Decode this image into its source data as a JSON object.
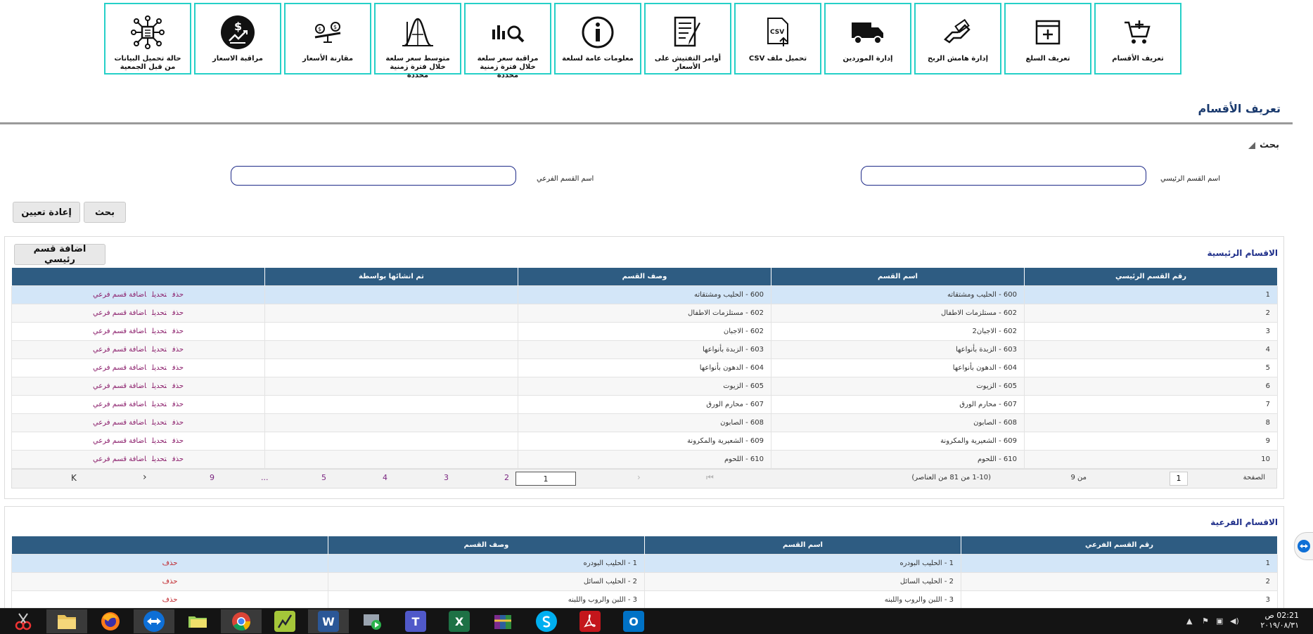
{
  "toolbar": {
    "tiles": [
      {
        "label": "تعريف الأقسام",
        "icon": "cart-add-icon"
      },
      {
        "label": "تعريف السلع",
        "icon": "add-box-icon"
      },
      {
        "label": "إدارة هامش الربح",
        "icon": "hand-money-icon"
      },
      {
        "label": "إدارة الموردين",
        "icon": "truck-icon"
      },
      {
        "label": "تحميل ملف CSV",
        "icon": "csv-upload-icon"
      },
      {
        "label": "أوامر التفتيش على الأسعار",
        "icon": "inspection-order-icon"
      },
      {
        "label": "معلومات عامة لسلعة",
        "icon": "info-icon"
      },
      {
        "label": "مراقبة سعر سلعة خلال فترة زمنية محددة",
        "icon": "chart-search-icon"
      },
      {
        "label": "متوسط سعر سلعة خلال فترة زمنية محددة",
        "icon": "bell-curve-icon"
      },
      {
        "label": "مقارنة الأسعار",
        "icon": "price-compare-icon"
      },
      {
        "label": "مراقبة الاسعار",
        "icon": "price-monitor-icon"
      },
      {
        "label": "حالة تحميل البيانات من قبل الجمعية",
        "icon": "data-network-icon"
      }
    ]
  },
  "page": {
    "title": "تعريف الأقسام",
    "search_toggle": "بحث"
  },
  "search": {
    "main_category_label": "اسم القسم الرئيسي",
    "main_category_value": "",
    "sub_category_label": "اسم القسم الفرعي",
    "sub_category_value": "",
    "search_button": "بحث",
    "reset_button": "إعادة تعيين"
  },
  "main_categories": {
    "title": "الاقسام الرئيسية",
    "add_button": "اضافة قسم رئيسي",
    "columns": [
      "رقم القسم الرئيسي",
      "اسم القسم",
      "وصف القسم",
      "تم انشائها بواسطة",
      ""
    ],
    "actions": {
      "delete": "حذف",
      "edit": "تحديل",
      "add_sub": "اضافة قسم فرعي"
    },
    "rows": [
      {
        "no": "1",
        "name": "600 - الحليب ومشتقاته",
        "desc": "600 - الحليب ومشتقاته",
        "created_by": ""
      },
      {
        "no": "2",
        "name": "602 - مستلزمات الاطفال",
        "desc": "602 - مستلزمات الاطفال",
        "created_by": ""
      },
      {
        "no": "3",
        "name": "602 - الاجبان2",
        "desc": "602 - الاجبان",
        "created_by": ""
      },
      {
        "no": "4",
        "name": "603 - الزبدة بأنواعها",
        "desc": "603 - الزبدة بأنواعها",
        "created_by": ""
      },
      {
        "no": "5",
        "name": "604 - الدهون بأنواعها",
        "desc": "604 - الدهون بأنواعها",
        "created_by": ""
      },
      {
        "no": "6",
        "name": "605 - الزيوت",
        "desc": "605 - الزيوت",
        "created_by": ""
      },
      {
        "no": "7",
        "name": "607 - محارم الورق",
        "desc": "607 - محارم الورق",
        "created_by": ""
      },
      {
        "no": "8",
        "name": "608 - الصابون",
        "desc": "608 - الصابون",
        "created_by": ""
      },
      {
        "no": "9",
        "name": "609 - الشعيرية والمكرونة",
        "desc": "609 - الشعيرية والمكرونة",
        "created_by": ""
      },
      {
        "no": "10",
        "name": "610 - اللحوم",
        "desc": "610 - اللحوم",
        "created_by": ""
      }
    ],
    "pager": {
      "page_label": "الصفحة",
      "page_value": "1",
      "of_label": "من 9",
      "range_text": "(1-10 من 81 من العناصر)",
      "current_page": "1",
      "pages": [
        "2",
        "3",
        "4",
        "5",
        "...",
        "9"
      ],
      "next": "‹",
      "last": "K"
    }
  },
  "sub_categories": {
    "title": "الاقسام الفرعية",
    "columns": [
      "رقم القسم الفرعي",
      "اسم القسم",
      "وصف القسم",
      ""
    ],
    "delete_label": "حذف",
    "rows": [
      {
        "no": "1",
        "name": "1 - الحليب البودره",
        "desc": "1 - الحليب البودره"
      },
      {
        "no": "2",
        "name": "2 - الحليب السائل",
        "desc": "2 - الحليب السائل"
      },
      {
        "no": "3",
        "name": "3 - اللبن والروب واللبنه",
        "desc": "3 - اللبن والروب واللبنه"
      }
    ]
  },
  "taskbar": {
    "apps": [
      "snipping-tool-icon",
      "file-explorer-icon",
      "firefox-icon",
      "teamviewer-icon",
      "folders-icon",
      "chrome-icon",
      "spreadsheet-tool-icon",
      "word-icon",
      "screen-recorder-icon",
      "teams-icon",
      "excel-icon",
      "winrar-icon",
      "skype-icon",
      "acrobat-icon",
      "outlook-icon"
    ],
    "word_letter": "W",
    "excel_letter": "X",
    "teams_letter": "T",
    "outlook_letter": "O",
    "clock_time": "02:21 ص",
    "clock_date": "٢٠١٩/٠٨/٣١"
  },
  "colors": {
    "header_bg": "#2e5c82",
    "tile_border": "#25d0c8",
    "link": "#8a1c6a",
    "selected_row": "#d3e6f8"
  }
}
